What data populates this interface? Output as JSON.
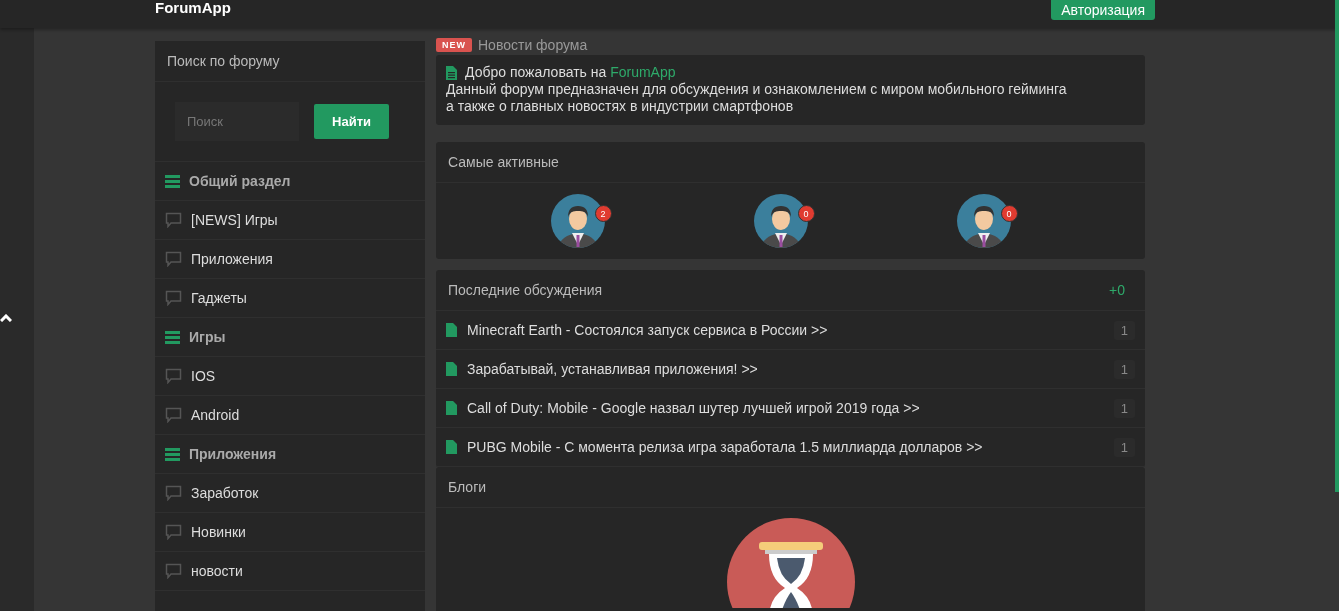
{
  "header": {
    "brand": "ForumApp",
    "login_button": "Авторизация"
  },
  "sidebar": {
    "title": "Поиск по форуму",
    "search": {
      "placeholder": "Поиск"
    },
    "search_button": "Найти",
    "items": [
      {
        "kind": "heading",
        "label": "Общий раздел"
      },
      {
        "kind": "forum",
        "label": "[NEWS] Игры"
      },
      {
        "kind": "forum",
        "label": "Приложения"
      },
      {
        "kind": "forum",
        "label": "Гаджеты"
      },
      {
        "kind": "heading",
        "label": "Игры"
      },
      {
        "kind": "forum",
        "label": "IOS"
      },
      {
        "kind": "forum",
        "label": "Android"
      },
      {
        "kind": "heading",
        "label": "Приложения"
      },
      {
        "kind": "forum",
        "label": "Заработок"
      },
      {
        "kind": "forum",
        "label": "Новинки"
      },
      {
        "kind": "forum",
        "label": "новости"
      }
    ]
  },
  "news": {
    "badge": "NEW",
    "title": "Новости форума",
    "welcome": "Добро пожаловать на",
    "brand": "ForumApp",
    "lines": [
      "Данный форум предназначен для обсуждения и ознакомлением с миром мобильного гейминга",
      "а также о главных новостях в индустрии смартфонов"
    ]
  },
  "active": {
    "title": "Самые активные",
    "users": [
      {
        "count": "2"
      },
      {
        "count": "0"
      },
      {
        "count": "0"
      }
    ]
  },
  "discussions": {
    "title": "Последние обсуждения",
    "new_count": "+0",
    "topics": [
      {
        "title": "Minecraft Earth - Состоялся запуск сервиса в России >>",
        "replies": "1"
      },
      {
        "title": "Зарабатывай, устанавливая приложения! >>",
        "replies": "1"
      },
      {
        "title": "Call of Duty: Mobile - Google назвал шутер лучшей игрой 2019 года >>",
        "replies": "1"
      },
      {
        "title": "PUBG Mobile - С момента релиза игра заработала 1.5 миллиарда долларов >>",
        "replies": "1"
      }
    ]
  },
  "blogs": {
    "title": "Блоги"
  }
}
